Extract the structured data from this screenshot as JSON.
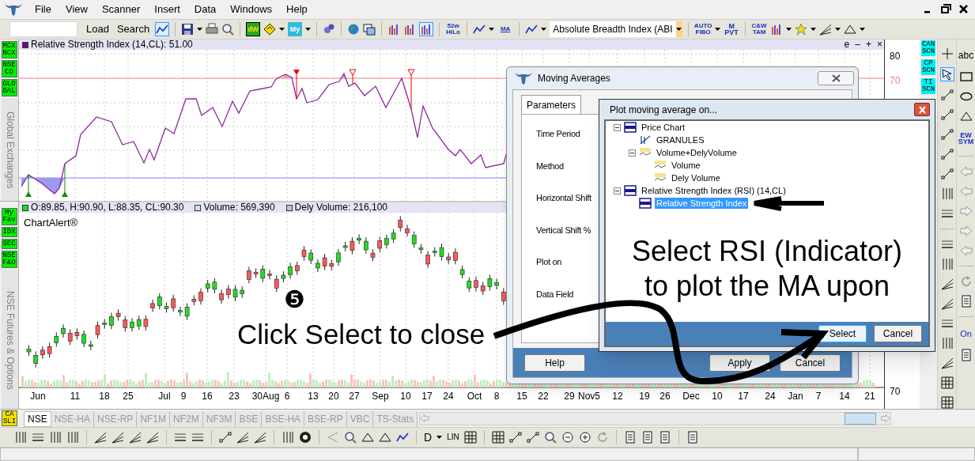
{
  "app_menu": [
    "File",
    "View",
    "Scanner",
    "Insert",
    "Data",
    "Windows",
    "Help"
  ],
  "toolbar": {
    "buttons": [
      "Load",
      "Search"
    ],
    "icon_labels": [
      [
        "dW"
      ],
      [
        "My"
      ],
      [
        "52w",
        "HiLo"
      ],
      [
        "MA"
      ],
      [
        "AUTO",
        "FIBO"
      ],
      [
        "M",
        "PVT"
      ],
      [
        "C&W",
        "TAM"
      ]
    ],
    "indicator_dropdown": "Absolute Breadth Index (ABI"
  },
  "left_strip": [
    {
      "title": "Global Exchanges",
      "badges": [
        [
          "MCX",
          "NCX"
        ],
        [
          "NSE",
          "CD"
        ],
        [
          "GLO",
          "BAL"
        ]
      ]
    },
    {
      "title": "NSE Futures & Options",
      "badges": [
        [
          "My",
          "Fav"
        ],
        [
          "IDX"
        ],
        [
          "SEC"
        ],
        [
          "NSE",
          "F&O"
        ]
      ]
    }
  ],
  "rsi_pane": {
    "title": "Relative Strength Index (14,CL): 51.00",
    "controls": [
      "e",
      "–",
      "+",
      "×"
    ]
  },
  "price_pane": {
    "legend": [
      {
        "text": "O:89.85, H:90.90, L:88.35, CL:90.30",
        "color": "#22dd22"
      },
      {
        "text": "Volume: 569,390",
        "color": "#c8ecc8"
      },
      {
        "text": "Dely Volume: 216,100",
        "color": "#c4c4c4"
      }
    ],
    "brand_label": "ChartAlert®"
  },
  "price_axis": [
    "80",
    "70",
    "70"
  ],
  "date_axis": [
    "Jun",
    "11",
    "18",
    "25",
    "Jul",
    "9",
    "16",
    "23",
    "30Aug",
    "6",
    "13",
    "20",
    "27",
    "Sep",
    "10",
    "17",
    "24",
    "Oct",
    "8",
    "15",
    "22",
    "29",
    "Nov5",
    "12",
    "19",
    "26",
    "Dec",
    "10",
    "17",
    "24",
    "Jan",
    "7",
    "14",
    "21"
  ],
  "scan_badges": [
    [
      "CAN",
      "SCN"
    ],
    [
      "CP",
      "SCN"
    ],
    [
      "TI",
      "SCN"
    ]
  ],
  "drawing_tool_labels": [
    [
      "abc"
    ],
    [
      "EW",
      "SYM"
    ],
    [
      "On"
    ]
  ],
  "bottom_left_badge": [
    "CA",
    "SLI"
  ],
  "exchange_tabs": [
    {
      "label": "NSE",
      "selected": true
    },
    {
      "label": "NSE-HA",
      "selected": false
    },
    {
      "label": "NSE-RP",
      "selected": false
    },
    {
      "label": "NF1M",
      "selected": false
    },
    {
      "label": "NF2M",
      "selected": false
    },
    {
      "label": "NF3M",
      "selected": false
    },
    {
      "label": "BSE",
      "selected": false
    },
    {
      "label": "BSE-HA",
      "selected": false
    },
    {
      "label": "BSE-RP",
      "selected": false
    },
    {
      "label": "VBC",
      "selected": false
    },
    {
      "label": "TS-Stats",
      "selected": false
    }
  ],
  "bottom_toolbar_labels": [
    [
      "D"
    ],
    [
      "LIN"
    ]
  ],
  "moving_averages_dialog": {
    "title": "Moving Averages",
    "tab": "Parameters",
    "fields": [
      "Time Period",
      "Method",
      "Horizontal Shift",
      "Vertical Shift %",
      "Plot on",
      "Data Field"
    ],
    "buttons": [
      "Help",
      "Apply",
      "Cancel"
    ]
  },
  "plot_dialog": {
    "title": "Plot moving average on...",
    "tree": [
      {
        "label": "Price Chart",
        "kind": "pane",
        "expanded": true,
        "selected": false,
        "children": [
          {
            "label": "GRANULES",
            "kind": "symbol",
            "selected": false
          },
          {
            "label": "Volume+DelyVolume",
            "kind": "volume",
            "expanded": true,
            "selected": false,
            "children": [
              {
                "label": "Volume",
                "kind": "volume",
                "selected": false
              },
              {
                "label": "Dely Volume",
                "kind": "volume",
                "selected": false
              }
            ]
          }
        ]
      },
      {
        "label": "Relative Strength Index (RSI) (14,CL)",
        "kind": "pane",
        "expanded": true,
        "selected": false,
        "children": [
          {
            "label": "Relative Strength Index",
            "kind": "pane",
            "selected": true
          }
        ]
      }
    ],
    "buttons": [
      "Select",
      "Cancel"
    ]
  },
  "annotations": {
    "step_number": "❺",
    "instruction": "Click Select to close",
    "callout": "Select RSI (Indicator) to plot the MA upon"
  }
}
